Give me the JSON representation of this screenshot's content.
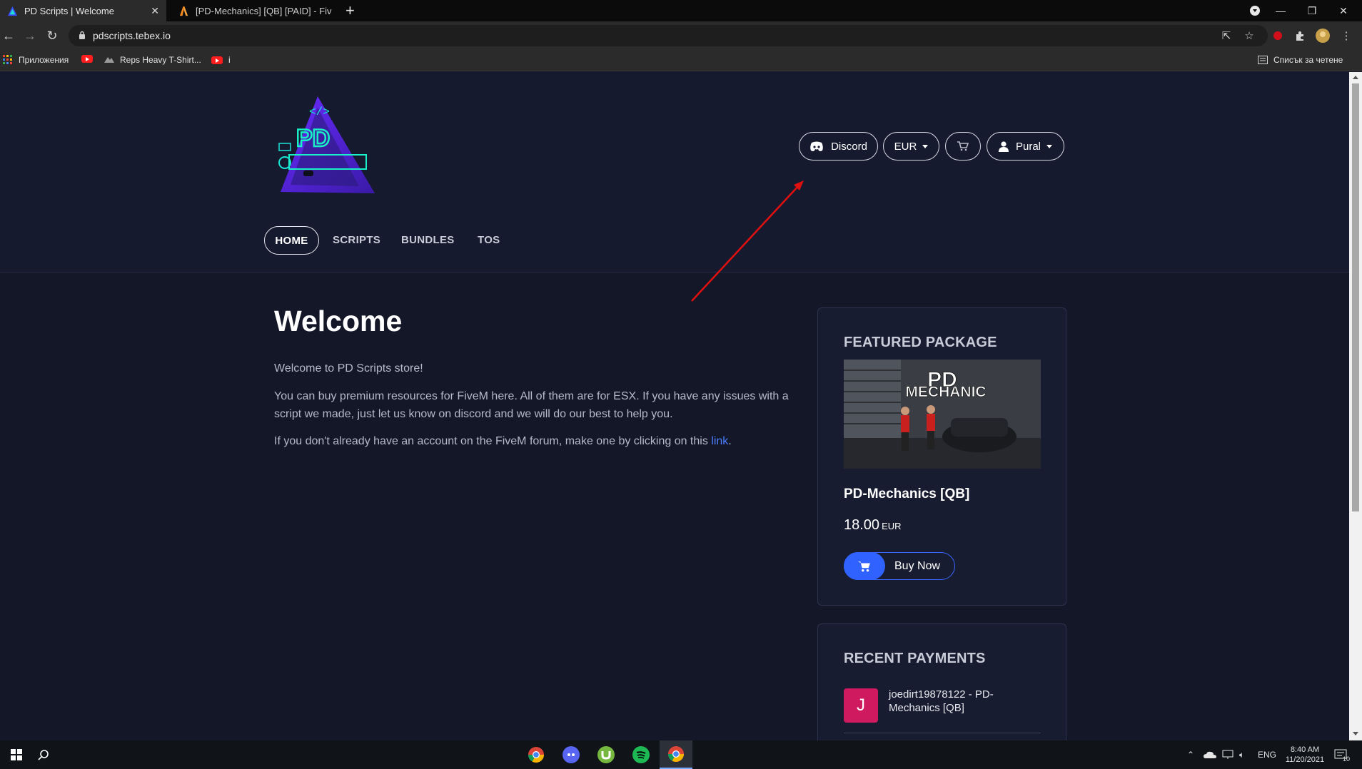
{
  "browser": {
    "tabs": [
      {
        "title": "PD Scripts | Welcome",
        "active": true
      },
      {
        "title": "[PD-Mechanics] [QB] [PAID] - Fiv",
        "active": false
      }
    ],
    "url": "pdscripts.tebex.io",
    "bookmarks": [
      {
        "label": "Приложения"
      },
      {
        "label": ""
      },
      {
        "label": "Reps Heavy T-Shirt..."
      },
      {
        "label": "i"
      }
    ],
    "reading_list": "Списък за четене"
  },
  "header": {
    "discord_label": "Discord",
    "currency_label": "EUR",
    "user_label": "Pural",
    "nav": [
      {
        "label": "HOME",
        "active": true
      },
      {
        "label": "SCRIPTS",
        "active": false
      },
      {
        "label": "BUNDLES",
        "active": false
      },
      {
        "label": "TOS",
        "active": false
      }
    ]
  },
  "main": {
    "title": "Welcome",
    "p1": "Welcome to PD Scripts store!",
    "p2": "You can buy premium resources for FiveM here. All of them are for ESX. If you have any issues with a script we made, just let us know on discord and we will do our best to help you.",
    "p3_before": "If you don't already have an account on the FiveM forum, make one by clicking on this ",
    "p3_link": "link",
    "p3_after": "."
  },
  "featured": {
    "heading": "FEATURED PACKAGE",
    "image_text_1": "PD",
    "image_text_2": "MECHANIC",
    "name": "PD-Mechanics [QB]",
    "price": "18.00",
    "currency": "EUR",
    "buy_label": "Buy Now"
  },
  "recent": {
    "heading": "RECENT PAYMENTS",
    "items": [
      {
        "initial": "J",
        "text": "joedirt19878122 - PD-Mechanics [QB]"
      }
    ]
  },
  "taskbar": {
    "language": "ENG",
    "time": "8:40 AM",
    "date": "11/20/2021",
    "notifications": "10"
  },
  "colors": {
    "page_bg": "#141728",
    "accent": "#2f62ff",
    "avatar": "#d01a5f",
    "annotation_arrow": "#e01010"
  }
}
